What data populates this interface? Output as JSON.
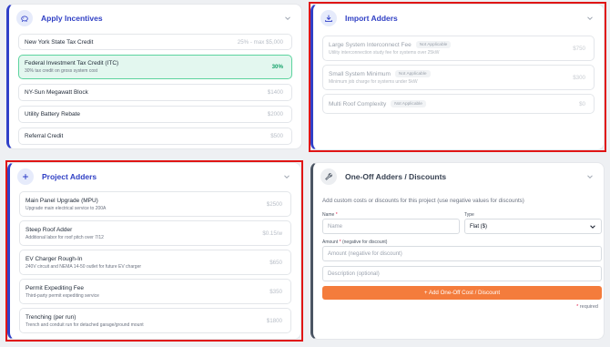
{
  "incentives": {
    "title": "Apply Incentives",
    "items": [
      {
        "name": "New York State Tax Credit",
        "desc": "",
        "value": "25% - max $5,000"
      },
      {
        "name": "Federal Investment Tax Credit (ITC)",
        "desc": "30% tax credit on gross system cost",
        "value": "30%"
      },
      {
        "name": "NY-Sun Megawatt Block",
        "desc": "",
        "value": "$1400"
      },
      {
        "name": "Utility Battery Rebate",
        "desc": "",
        "value": "$2000"
      },
      {
        "name": "Referral Credit",
        "desc": "",
        "value": "$500"
      }
    ]
  },
  "import_adders": {
    "title": "Import Adders",
    "items": [
      {
        "name": "Large System Interconnect Fee",
        "badge": "Not Applicable",
        "desc": "Utility interconnection study fee for systems over 25kW",
        "value": "$750"
      },
      {
        "name": "Small System Minimum",
        "badge": "Not Applicable",
        "desc": "Minimum job charge for systems under 5kW",
        "value": "$300"
      },
      {
        "name": "Multi Roof Complexity",
        "badge": "Not Applicable",
        "desc": "",
        "value": "$0"
      }
    ]
  },
  "project_adders": {
    "title": "Project Adders",
    "items": [
      {
        "name": "Main Panel Upgrade (MPU)",
        "desc": "Upgrade main electrical service to 200A",
        "value": "$2500"
      },
      {
        "name": "Steep Roof Adder",
        "desc": "Additional labor for roof pitch over 7/12",
        "value": "$0.15/w"
      },
      {
        "name": "EV Charger Rough-In",
        "desc": "240V circuit and NEMA 14-50 outlet for future EV charger",
        "value": "$650"
      },
      {
        "name": "Permit Expediting Fee",
        "desc": "Third-party permit expediting service",
        "value": "$350"
      },
      {
        "name": "Trenching (per run)",
        "desc": "Trench and conduit run for detached garage/ground mount",
        "value": "$1800"
      }
    ]
  },
  "oneoff": {
    "title": "One-Off Adders / Discounts",
    "subtitle": "Add custom costs or discounts for this project (use negative values for discounts)",
    "name_label": "Name",
    "name_req": "*",
    "name_placeholder": "Name",
    "type_label": "Type",
    "type_value": "Flat ($)",
    "amount_label": "Amount",
    "amount_req": "*",
    "amount_hint": "(negative for discount)",
    "amount_placeholder": "Amount (negative for discount)",
    "description_placeholder": "Description (optional)",
    "add_button": "+ Add One-Off Cost / Discount",
    "required_star": "*",
    "required_note": "required"
  },
  "colors": {
    "accent_blue": "#2f3fc4",
    "highlight_red": "#e01515",
    "selected_green": "#16a36b",
    "orange_button": "#f47c3c"
  }
}
